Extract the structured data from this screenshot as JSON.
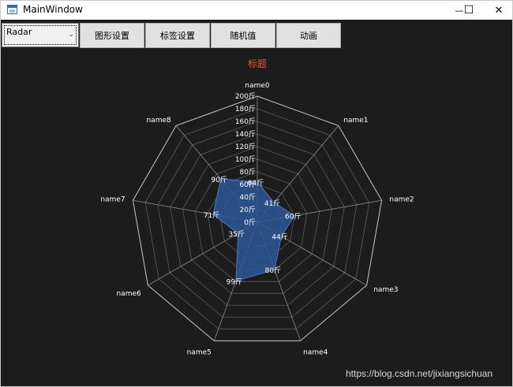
{
  "window": {
    "title": "MainWindow",
    "minimize_glyph": "—",
    "maximize_glyph": "☐",
    "close_glyph": "✕"
  },
  "toolbar": {
    "combo_value": "Radar",
    "buttons": [
      "图形设置",
      "标签设置",
      "随机值",
      "动画"
    ]
  },
  "chart_data": {
    "type": "radar",
    "title": "标题",
    "title_color": "#e8573c",
    "axes": [
      "name0",
      "name1",
      "name2",
      "name3",
      "name4",
      "name5",
      "name6",
      "name7",
      "name8"
    ],
    "rmax": 200,
    "ticks": [
      0,
      20,
      40,
      60,
      80,
      100,
      120,
      140,
      160,
      180,
      200
    ],
    "tick_suffix": "斤",
    "series": [
      {
        "values": [
          64,
          41,
          60,
          44,
          80,
          99,
          35,
          71,
          90
        ],
        "color": "#2b5797"
      }
    ],
    "grid": true
  },
  "watermark": "https://blog.csdn.net/jixiangsichuan"
}
